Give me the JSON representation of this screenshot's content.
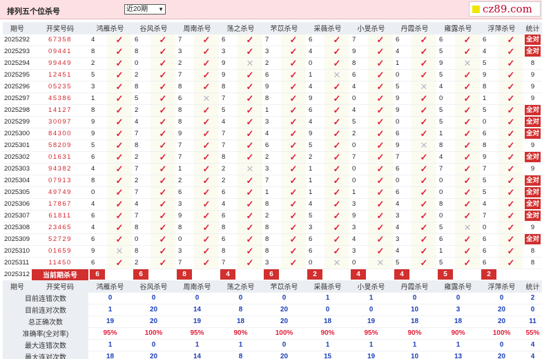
{
  "page": {
    "title": "排列五个位杀号",
    "period_select": "近20期",
    "logo_text": "cz89.com"
  },
  "colors": {
    "accent": "#d22f2f",
    "check": "#e0203a",
    "number_blue": "#1a3fb8",
    "header_bg": "#ebeef3",
    "topbar_bg": "#fde0e3"
  },
  "headers": {
    "num": "期号",
    "code": "开奖号码",
    "methods": [
      "鸿雁杀号",
      "谷风杀号",
      "周南杀号",
      "荡之杀号",
      "芣苡杀号",
      "采薇杀号",
      "小旻杀号",
      "丹霞杀号",
      "雍露杀号",
      "浮萍杀号"
    ],
    "total": "统计"
  },
  "rows": [
    {
      "num": "2025292",
      "code": "67358",
      "v": [
        "4",
        "6",
        "7",
        "6",
        "7",
        "6",
        "7",
        "6",
        "6",
        "6"
      ],
      "m": [
        "c",
        "c",
        "c",
        "c",
        "c",
        "c",
        "c",
        "c",
        "c",
        "c"
      ],
      "total": "全对"
    },
    {
      "num": "2025293",
      "code": "09441",
      "v": [
        "8",
        "8",
        "3",
        "3",
        "3",
        "4",
        "9",
        "4",
        "5",
        "4"
      ],
      "m": [
        "c",
        "c",
        "c",
        "c",
        "c",
        "c",
        "c",
        "c",
        "c",
        "c"
      ],
      "total": "全对"
    },
    {
      "num": "2025294",
      "code": "99449",
      "v": [
        "2",
        "0",
        "2",
        "9",
        "2",
        "0",
        "8",
        "1",
        "9",
        "5"
      ],
      "m": [
        "c",
        "c",
        "c",
        "x",
        "c",
        "c",
        "c",
        "c",
        "x",
        "c"
      ],
      "total": "8"
    },
    {
      "num": "2025295",
      "code": "12451",
      "v": [
        "5",
        "2",
        "7",
        "9",
        "6",
        "1",
        "6",
        "0",
        "5",
        "9"
      ],
      "m": [
        "c",
        "c",
        "c",
        "c",
        "c",
        "x",
        "c",
        "c",
        "c",
        "c"
      ],
      "total": "9"
    },
    {
      "num": "2025296",
      "code": "05235",
      "v": [
        "3",
        "8",
        "8",
        "8",
        "9",
        "4",
        "4",
        "5",
        "4",
        "8"
      ],
      "m": [
        "c",
        "c",
        "c",
        "c",
        "c",
        "c",
        "c",
        "x",
        "c",
        "c"
      ],
      "total": "9"
    },
    {
      "num": "2025297",
      "code": "45386",
      "v": [
        "1",
        "5",
        "6",
        "7",
        "8",
        "9",
        "0",
        "9",
        "0",
        "1"
      ],
      "m": [
        "c",
        "c",
        "x",
        "c",
        "c",
        "c",
        "c",
        "c",
        "c",
        "c"
      ],
      "total": "9"
    },
    {
      "num": "2025298",
      "code": "14127",
      "v": [
        "8",
        "2",
        "8",
        "5",
        "1",
        "6",
        "4",
        "9",
        "5",
        "5"
      ],
      "m": [
        "c",
        "c",
        "c",
        "c",
        "c",
        "c",
        "c",
        "c",
        "c",
        "c"
      ],
      "total": "全对"
    },
    {
      "num": "2025299",
      "code": "30097",
      "v": [
        "9",
        "4",
        "8",
        "4",
        "3",
        "4",
        "5",
        "0",
        "5",
        "0"
      ],
      "m": [
        "c",
        "c",
        "c",
        "c",
        "c",
        "c",
        "c",
        "c",
        "c",
        "c"
      ],
      "total": "全对"
    },
    {
      "num": "2025300",
      "code": "84300",
      "v": [
        "9",
        "7",
        "9",
        "7",
        "4",
        "9",
        "2",
        "6",
        "1",
        "6"
      ],
      "m": [
        "c",
        "c",
        "c",
        "c",
        "c",
        "c",
        "c",
        "c",
        "c",
        "c"
      ],
      "total": "全对"
    },
    {
      "num": "2025301",
      "code": "58209",
      "v": [
        "5",
        "8",
        "7",
        "7",
        "6",
        "5",
        "0",
        "9",
        "8",
        "8"
      ],
      "m": [
        "c",
        "c",
        "c",
        "c",
        "c",
        "c",
        "c",
        "x",
        "c",
        "c"
      ],
      "total": "9"
    },
    {
      "num": "2025302",
      "code": "01631",
      "v": [
        "6",
        "2",
        "7",
        "8",
        "2",
        "2",
        "7",
        "7",
        "4",
        "9"
      ],
      "m": [
        "c",
        "c",
        "c",
        "c",
        "c",
        "c",
        "c",
        "c",
        "c",
        "c"
      ],
      "total": "全对"
    },
    {
      "num": "2025303",
      "code": "94382",
      "v": [
        "4",
        "7",
        "1",
        "2",
        "3",
        "1",
        "0",
        "6",
        "7",
        "7"
      ],
      "m": [
        "c",
        "c",
        "c",
        "x",
        "c",
        "c",
        "c",
        "c",
        "c",
        "c"
      ],
      "total": "9"
    },
    {
      "num": "2025304",
      "code": "07913",
      "v": [
        "8",
        "2",
        "2",
        "2",
        "7",
        "1",
        "0",
        "0",
        "0",
        "5"
      ],
      "m": [
        "c",
        "c",
        "c",
        "c",
        "c",
        "c",
        "c",
        "c",
        "c",
        "c"
      ],
      "total": "全对"
    },
    {
      "num": "2025305",
      "code": "49749",
      "v": [
        "0",
        "7",
        "6",
        "6",
        "1",
        "1",
        "1",
        "6",
        "0",
        "5"
      ],
      "m": [
        "c",
        "c",
        "c",
        "c",
        "c",
        "c",
        "c",
        "c",
        "c",
        "c"
      ],
      "total": "全对"
    },
    {
      "num": "2025306",
      "code": "17867",
      "v": [
        "4",
        "4",
        "3",
        "4",
        "8",
        "4",
        "3",
        "4",
        "8",
        "4"
      ],
      "m": [
        "c",
        "c",
        "c",
        "c",
        "c",
        "c",
        "c",
        "c",
        "c",
        "c"
      ],
      "total": "全对"
    },
    {
      "num": "2025307",
      "code": "61811",
      "v": [
        "6",
        "7",
        "9",
        "6",
        "2",
        "5",
        "9",
        "3",
        "0",
        "7"
      ],
      "m": [
        "c",
        "c",
        "c",
        "c",
        "c",
        "c",
        "c",
        "c",
        "c",
        "c"
      ],
      "total": "全对"
    },
    {
      "num": "2025308",
      "code": "23465",
      "v": [
        "4",
        "8",
        "8",
        "8",
        "8",
        "3",
        "3",
        "4",
        "5",
        "0"
      ],
      "m": [
        "c",
        "c",
        "c",
        "c",
        "c",
        "c",
        "c",
        "c",
        "x",
        "c"
      ],
      "total": "9"
    },
    {
      "num": "2025309",
      "code": "52729",
      "v": [
        "6",
        "0",
        "0",
        "6",
        "8",
        "6",
        "4",
        "3",
        "6",
        "6"
      ],
      "m": [
        "c",
        "c",
        "c",
        "c",
        "c",
        "c",
        "c",
        "c",
        "c",
        "c"
      ],
      "total": "全对"
    },
    {
      "num": "2025310",
      "code": "01659",
      "v": [
        "9",
        "8",
        "3",
        "8",
        "8",
        "6",
        "3",
        "4",
        "1",
        "6"
      ],
      "m": [
        "x",
        "c",
        "c",
        "c",
        "c",
        "c",
        "c",
        "c",
        "c",
        "c"
      ],
      "total": "8"
    },
    {
      "num": "2025311",
      "code": "11450",
      "v": [
        "6",
        "2",
        "7",
        "7",
        "3",
        "0",
        "0",
        "5",
        "5",
        "6"
      ],
      "m": [
        "c",
        "c",
        "c",
        "c",
        "c",
        "x",
        "x",
        "c",
        "c",
        "c"
      ],
      "total": "8"
    }
  ],
  "current": {
    "num": "2025312",
    "label": "当前期杀号",
    "values": [
      "6",
      "6",
      "8",
      "4",
      "6",
      "2",
      "4",
      "4",
      "5",
      "2"
    ]
  },
  "stats": [
    {
      "label": "目前连错次数",
      "values": [
        "0",
        "0",
        "0",
        "0",
        "0",
        "1",
        "1",
        "0",
        "0",
        "0"
      ],
      "total": "2",
      "type": "n"
    },
    {
      "label": "目前连对次数",
      "values": [
        "1",
        "20",
        "14",
        "8",
        "20",
        "0",
        "0",
        "10",
        "3",
        "20"
      ],
      "total": "0",
      "type": "n"
    },
    {
      "label": "总正确次数",
      "values": [
        "19",
        "20",
        "19",
        "18",
        "20",
        "18",
        "19",
        "18",
        "18",
        "20"
      ],
      "total": "11",
      "type": "n"
    },
    {
      "label": "准确率(全对率)",
      "values": [
        "95%",
        "100%",
        "95%",
        "90%",
        "100%",
        "90%",
        "95%",
        "90%",
        "90%",
        "100%"
      ],
      "total": "55%",
      "type": "r"
    },
    {
      "label": "最大连错次数",
      "values": [
        "1",
        "0",
        "1",
        "1",
        "0",
        "1",
        "1",
        "1",
        "1",
        "0"
      ],
      "total": "4",
      "type": "n"
    },
    {
      "label": "最大连对次数",
      "values": [
        "18",
        "20",
        "14",
        "8",
        "20",
        "15",
        "19",
        "10",
        "13",
        "20"
      ],
      "total": "4",
      "type": "n"
    }
  ]
}
